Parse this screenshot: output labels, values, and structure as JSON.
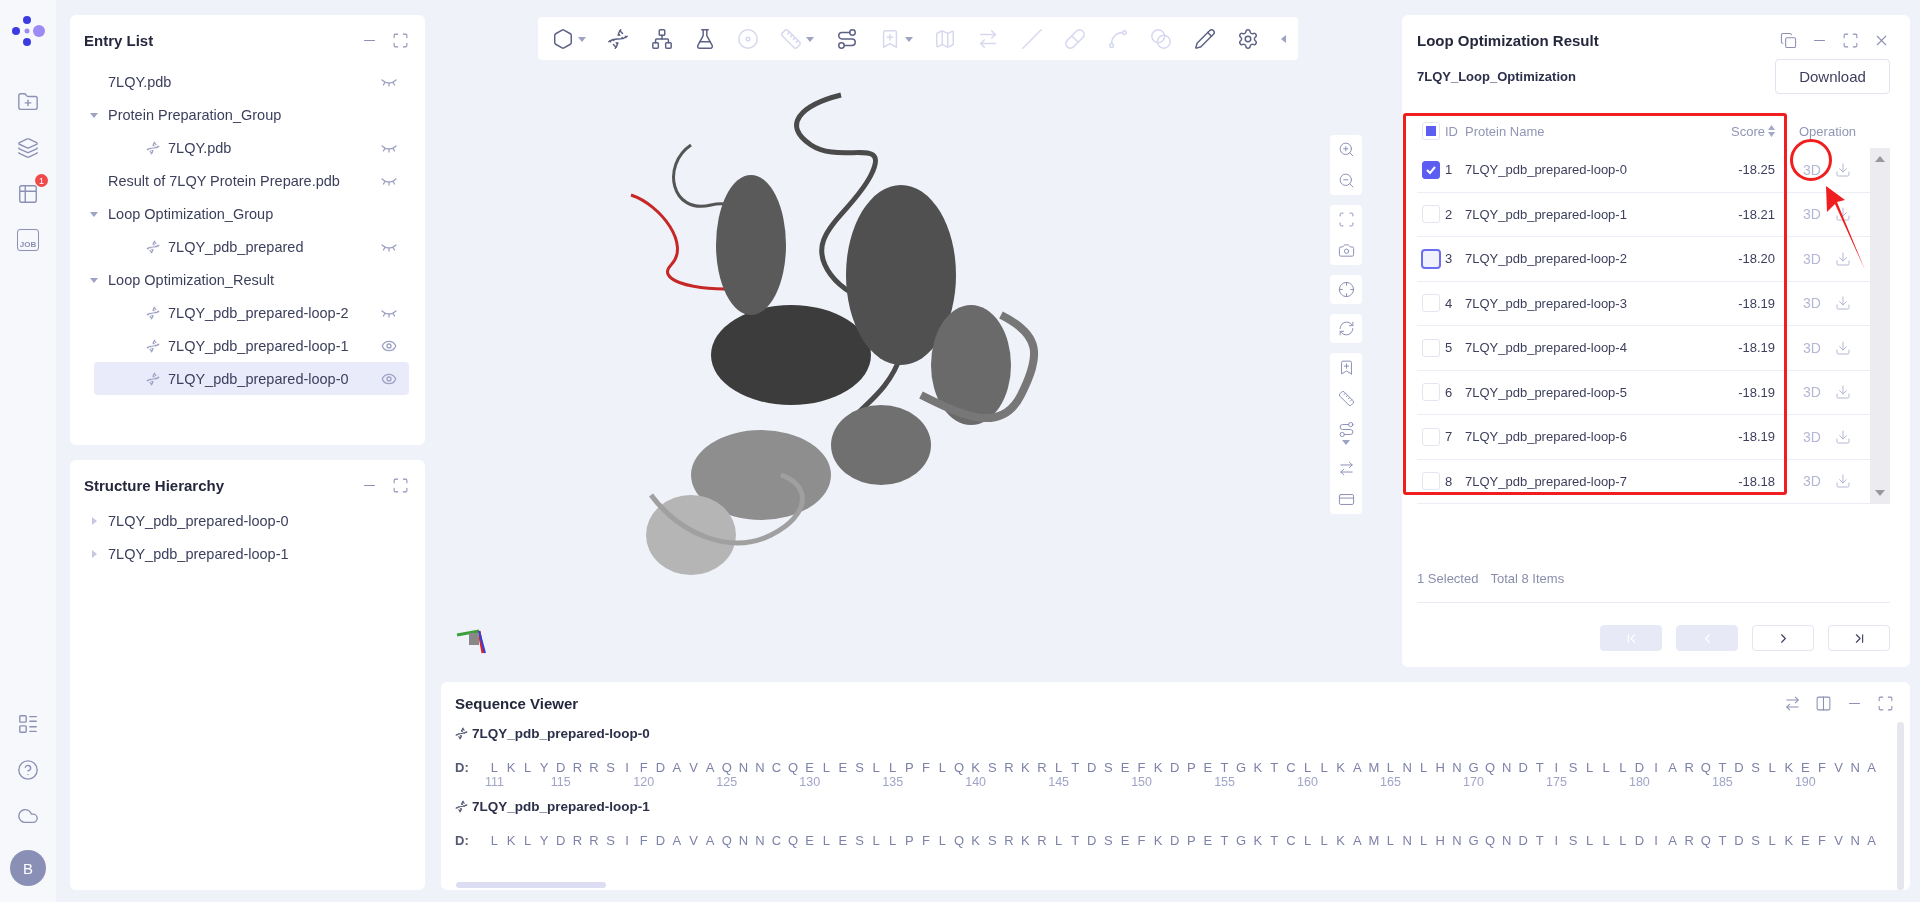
{
  "rail": {
    "top": [
      {
        "kind": "folder-add"
      },
      {
        "kind": "layers"
      },
      {
        "kind": "table",
        "badge": "1"
      },
      {
        "kind": "job",
        "label": "JOB"
      }
    ],
    "bottom": [
      {
        "kind": "list"
      },
      {
        "kind": "help"
      },
      {
        "kind": "cloud"
      }
    ],
    "avatar": "B"
  },
  "entry_list": {
    "title": "Entry List",
    "items": [
      {
        "label": "7LQY.pdb",
        "visible": false,
        "selected": false
      },
      {
        "label": "Protein Preparation_Group",
        "expanded": true,
        "selected": false,
        "children": [
          {
            "label": "7LQY.pdb",
            "visible": false,
            "selected": false
          }
        ]
      },
      {
        "label": "Result of 7LQY Protein Prepare.pdb",
        "visible": false,
        "selected": false
      },
      {
        "label": "Loop Optimization_Group",
        "expanded": true,
        "selected": false,
        "children": [
          {
            "label": "7LQY_pdb_prepared",
            "visible": false,
            "selected": false
          }
        ]
      },
      {
        "label": "Loop Optimization_Result",
        "expanded": true,
        "selected": false,
        "children": [
          {
            "label": "7LQY_pdb_prepared-loop-2",
            "visible": false,
            "selected": false
          },
          {
            "label": "7LQY_pdb_prepared-loop-1",
            "visible": true,
            "selected": false
          },
          {
            "label": "7LQY_pdb_prepared-loop-0",
            "visible": true,
            "selected": true
          }
        ]
      }
    ]
  },
  "structure_hierarchy": {
    "title": "Structure Hierarchy",
    "items": [
      {
        "label": "7LQY_pdb_prepared-loop-0",
        "expanded": false
      },
      {
        "label": "7LQY_pdb_prepared-loop-1",
        "expanded": false
      }
    ]
  },
  "viewer": {
    "toolbar": [
      {
        "kind": "hexagon",
        "disabled": false,
        "menu": true
      },
      {
        "kind": "helix",
        "disabled": false
      },
      {
        "kind": "molecule",
        "disabled": false
      },
      {
        "kind": "flask",
        "disabled": false
      },
      {
        "kind": "target",
        "disabled": true
      },
      {
        "kind": "ruler",
        "disabled": true,
        "menu": true
      },
      {
        "kind": "route",
        "disabled": false
      },
      {
        "kind": "bookmark",
        "disabled": true,
        "menu": true
      },
      {
        "kind": "map",
        "disabled": true
      },
      {
        "kind": "swap",
        "disabled": true
      },
      {
        "kind": "line",
        "disabled": true
      },
      {
        "kind": "pill",
        "disabled": true
      },
      {
        "kind": "link",
        "disabled": true
      },
      {
        "kind": "blend",
        "disabled": true
      },
      {
        "kind": "pencil",
        "disabled": false
      },
      {
        "kind": "settings",
        "disabled": false
      }
    ],
    "side_groups": [
      [
        {
          "kind": "zoom-in"
        },
        {
          "kind": "zoom-out"
        }
      ],
      [
        {
          "kind": "fit"
        },
        {
          "kind": "camera"
        }
      ],
      [
        {
          "kind": "crosshair"
        }
      ],
      [
        {
          "kind": "refresh"
        }
      ],
      [
        {
          "kind": "bookmark"
        },
        {
          "kind": "ruler"
        },
        {
          "kind": "route",
          "menu": true
        },
        {
          "kind": "swap"
        },
        {
          "kind": "card"
        }
      ]
    ]
  },
  "result_panel": {
    "title": "Loop Optimization Result",
    "subtitle": "7LQY_Loop_Optimization",
    "download": "Download",
    "header_checkbox": {
      "indeterminate": true
    },
    "columns": {
      "id": "ID",
      "name": "Protein Name",
      "score": "Score",
      "operation": "Operation"
    },
    "rows": [
      {
        "id": "1",
        "name": "7LQY_pdb_prepared-loop-0",
        "score": "-18.25",
        "view": "3D",
        "checked": true
      },
      {
        "id": "2",
        "name": "7LQY_pdb_prepared-loop-1",
        "score": "-18.21",
        "view": "3D",
        "checked": false
      },
      {
        "id": "3",
        "name": "7LQY_pdb_prepared-loop-2",
        "score": "-18.20",
        "view": "3D",
        "checked": false,
        "focused": true
      },
      {
        "id": "4",
        "name": "7LQY_pdb_prepared-loop-3",
        "score": "-18.19",
        "view": "3D",
        "checked": false
      },
      {
        "id": "5",
        "name": "7LQY_pdb_prepared-loop-4",
        "score": "-18.19",
        "view": "3D",
        "checked": false
      },
      {
        "id": "6",
        "name": "7LQY_pdb_prepared-loop-5",
        "score": "-18.19",
        "view": "3D",
        "checked": false
      },
      {
        "id": "7",
        "name": "7LQY_pdb_prepared-loop-6",
        "score": "-18.19",
        "view": "3D",
        "checked": false
      },
      {
        "id": "8",
        "name": "7LQY_pdb_prepared-loop-7",
        "score": "-18.18",
        "view": "3D",
        "checked": false
      }
    ],
    "selected_text": "1 Selected",
    "total_text": "Total 8 Items",
    "pager": [
      {
        "kind": "first",
        "disabled": true
      },
      {
        "kind": "prev",
        "disabled": true
      },
      {
        "kind": "next",
        "disabled": false
      },
      {
        "kind": "last",
        "disabled": false
      }
    ]
  },
  "annotations": [
    {
      "kind": "rectangle"
    },
    {
      "kind": "circle"
    },
    {
      "kind": "arrow"
    }
  ],
  "sequence_viewer": {
    "title": "Sequence Viewer",
    "entries": [
      {
        "name": "7LQY_pdb_prepared-loop-0",
        "chain": "D:",
        "residues": [
          "L",
          "K",
          "L",
          "Y",
          "D",
          "R",
          "R",
          "S",
          "I",
          "F",
          "D",
          "A",
          "V",
          "A",
          "Q",
          "N",
          "N",
          "C",
          "Q",
          "E",
          "L",
          "E",
          "S",
          "L",
          "L",
          "P",
          "F",
          "L",
          "Q",
          "K",
          "S",
          "R",
          "K",
          "R",
          "L",
          "T",
          "D",
          "S",
          "E",
          "F",
          "K",
          "D",
          "P",
          "E",
          "T",
          "G",
          "K",
          "T",
          "C",
          "L",
          "L",
          "K",
          "A",
          "M",
          "L",
          "N",
          "L",
          "H",
          "N",
          "G",
          "Q",
          "N",
          "D",
          "T",
          "I",
          "S",
          "L",
          "L",
          "L",
          "D",
          "I",
          "A",
          "R",
          "Q",
          "T",
          "D",
          "S",
          "L",
          "K",
          "E",
          "F",
          "V",
          "N",
          "A"
        ],
        "ticks": [
          "111",
          "115",
          "120",
          "125",
          "130",
          "135",
          "140",
          "145",
          "150",
          "155",
          "160",
          "165",
          "170",
          "175",
          "180",
          "185",
          "190"
        ]
      },
      {
        "name": "7LQY_pdb_prepared-loop-1",
        "chain": "D:",
        "residues": [
          "L",
          "K",
          "L",
          "Y",
          "D",
          "R",
          "R",
          "S",
          "I",
          "F",
          "D",
          "A",
          "V",
          "A",
          "Q",
          "N",
          "N",
          "C",
          "Q",
          "E",
          "L",
          "E",
          "S",
          "L",
          "L",
          "P",
          "F",
          "L",
          "Q",
          "K",
          "S",
          "R",
          "K",
          "R",
          "L",
          "T",
          "D",
          "S",
          "E",
          "F",
          "K",
          "D",
          "P",
          "E",
          "T",
          "G",
          "K",
          "T",
          "C",
          "L",
          "L",
          "K",
          "A",
          "M",
          "L",
          "N",
          "L",
          "H",
          "N",
          "G",
          "Q",
          "N",
          "D",
          "T",
          "I",
          "S",
          "L",
          "L",
          "L",
          "D",
          "I",
          "A",
          "R",
          "Q",
          "T",
          "D",
          "S",
          "L",
          "K",
          "E",
          "F",
          "V",
          "N",
          "A"
        ]
      }
    ]
  }
}
